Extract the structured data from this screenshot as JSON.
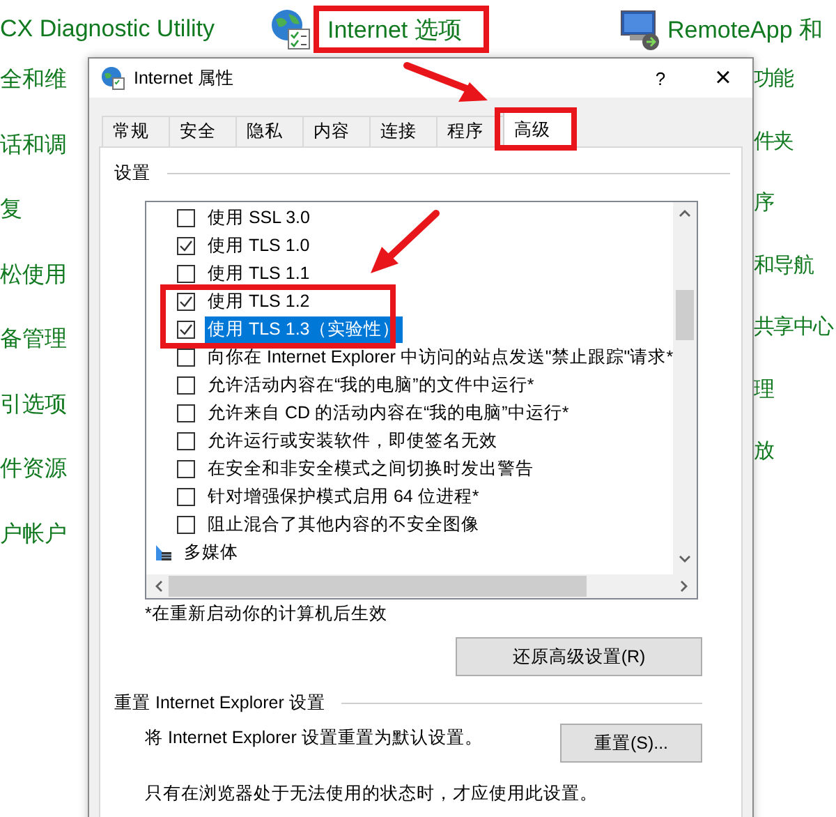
{
  "background": {
    "top_items": [
      "CX Diagnostic Utility",
      "Internet 选项",
      "RemoteApp 和"
    ],
    "left_items": [
      "全和维",
      "话和调",
      "复",
      "松使用",
      "备管理",
      "引选项",
      "件资源",
      "户帐户"
    ],
    "right_items": [
      "功能",
      "件夹",
      "序",
      "和导航",
      "共享中心",
      "理",
      "放"
    ]
  },
  "window": {
    "title": "Internet 属性",
    "help": "?",
    "close": "×"
  },
  "tabs": [
    {
      "label": "常规",
      "selected": false
    },
    {
      "label": "安全",
      "selected": false
    },
    {
      "label": "隐私",
      "selected": false
    },
    {
      "label": "内容",
      "selected": false
    },
    {
      "label": "连接",
      "selected": false
    },
    {
      "label": "程序",
      "selected": false
    },
    {
      "label": "高级",
      "selected": true
    }
  ],
  "settings": {
    "heading": "设置",
    "items": [
      {
        "kind": "checkbox",
        "label": "使用 SSL 3.0",
        "checked": false,
        "selected": false
      },
      {
        "kind": "checkbox",
        "label": "使用 TLS 1.0",
        "checked": true,
        "selected": false
      },
      {
        "kind": "checkbox",
        "label": "使用 TLS 1.1",
        "checked": false,
        "selected": false
      },
      {
        "kind": "checkbox",
        "label": "使用 TLS 1.2",
        "checked": true,
        "selected": false
      },
      {
        "kind": "checkbox",
        "label": "使用 TLS 1.3（实验性）",
        "checked": true,
        "selected": true
      },
      {
        "kind": "checkbox",
        "label": "向你在 Internet Explorer 中访问的站点发送\"禁止跟踪\"请求*",
        "checked": false,
        "selected": false
      },
      {
        "kind": "checkbox",
        "label": "允许活动内容在“我的电脑”的文件中运行*",
        "checked": false,
        "selected": false
      },
      {
        "kind": "checkbox",
        "label": "允许来自 CD 的活动内容在“我的电脑”中运行*",
        "checked": false,
        "selected": false
      },
      {
        "kind": "checkbox",
        "label": "允许运行或安装软件，即使签名无效",
        "checked": false,
        "selected": false
      },
      {
        "kind": "checkbox",
        "label": "在安全和非安全模式之间切换时发出警告",
        "checked": false,
        "selected": false
      },
      {
        "kind": "checkbox",
        "label": "针对增强保护模式启用 64 位进程*",
        "checked": false,
        "selected": false
      },
      {
        "kind": "checkbox",
        "label": "阻止混合了其他内容的不安全图像",
        "checked": false,
        "selected": false
      },
      {
        "kind": "group",
        "label": "多媒体",
        "selected": false
      }
    ],
    "note": "*在重新启动你的计算机后生效",
    "restore_button": "还原高级设置(R)"
  },
  "reset": {
    "heading": "重置 Internet Explorer 设置",
    "description": "将 Internet Explorer 设置重置为默认设置。",
    "button": "重置(S)...",
    "warning": "只有在浏览器处于无法使用的状态时，才应使用此设置。"
  }
}
